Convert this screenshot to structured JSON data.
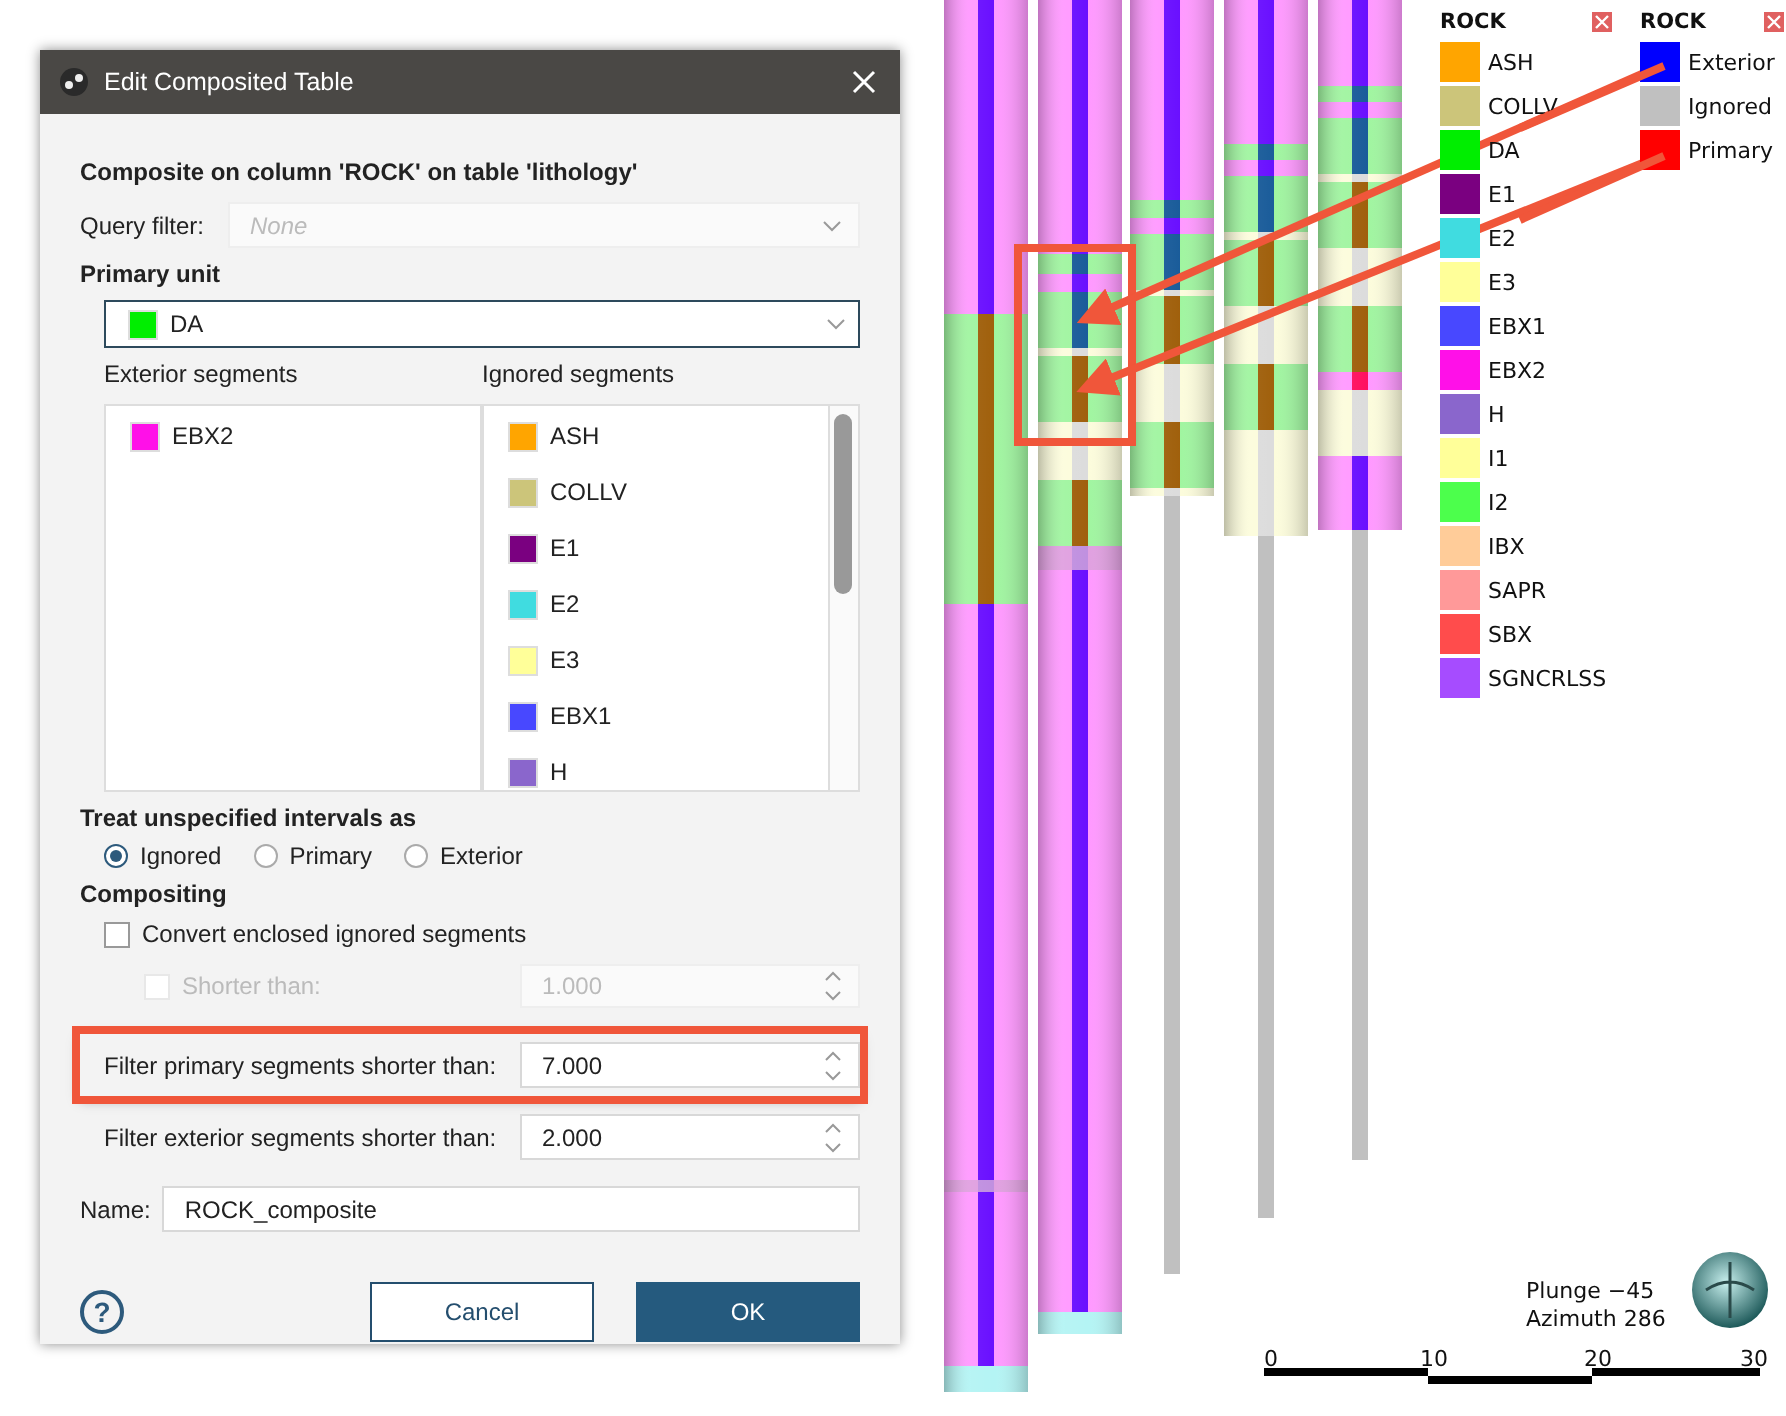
{
  "dialog": {
    "title": "Edit Composited Table",
    "heading": "Composite on column 'ROCK' on table 'lithology'",
    "query_filter": {
      "label": "Query filter:",
      "placeholder": "None",
      "disabled": true
    },
    "primary_unit": {
      "label": "Primary unit",
      "value": "DA",
      "color": "#00ee00"
    },
    "exterior_segments": {
      "label": "Exterior segments",
      "items": [
        {
          "label": "EBX2",
          "color": "#ff10e8"
        }
      ]
    },
    "ignored_segments": {
      "label": "Ignored segments",
      "items": [
        {
          "label": "ASH",
          "color": "#ffa500"
        },
        {
          "label": "COLLV",
          "color": "#ccc57a"
        },
        {
          "label": "E1",
          "color": "#7a0080"
        },
        {
          "label": "E2",
          "color": "#40dce0"
        },
        {
          "label": "E3",
          "color": "#ffff99"
        },
        {
          "label": "EBX1",
          "color": "#4848ff"
        },
        {
          "label": "H",
          "color": "#8a66cc"
        }
      ]
    },
    "treat_unspecified": {
      "label": "Treat unspecified intervals as",
      "options": [
        {
          "label": "Ignored",
          "selected": true
        },
        {
          "label": "Primary",
          "selected": false
        },
        {
          "label": "Exterior",
          "selected": false
        }
      ]
    },
    "compositing": {
      "label": "Compositing",
      "convert": {
        "label": "Convert enclosed ignored segments",
        "checked": false
      },
      "shorter_than": {
        "label": "Shorter than:",
        "value": "1.000",
        "checked": false,
        "disabled": true
      }
    },
    "filter_primary": {
      "label": "Filter primary segments shorter than:",
      "value": "7.000",
      "highlighted": true
    },
    "filter_exterior": {
      "label": "Filter exterior segments shorter than:",
      "value": "2.000"
    },
    "name": {
      "label": "Name:",
      "value": "ROCK_composite"
    },
    "help": "?",
    "buttons": [
      {
        "label": "Cancel",
        "kind": "secondary"
      },
      {
        "label": "OK",
        "kind": "primary"
      }
    ]
  },
  "viewer": {
    "legends": [
      {
        "title": "ROCK",
        "items": [
          {
            "label": "ASH",
            "color": "#ffa500"
          },
          {
            "label": "COLLV",
            "color": "#ccc57a"
          },
          {
            "label": "DA",
            "color": "#00ee00"
          },
          {
            "label": "E1",
            "color": "#7a0080"
          },
          {
            "label": "E2",
            "color": "#40dce0"
          },
          {
            "label": "E3",
            "color": "#ffff99"
          },
          {
            "label": "EBX1",
            "color": "#4848ff"
          },
          {
            "label": "EBX2",
            "color": "#ff10e8"
          },
          {
            "label": "H",
            "color": "#8a66cc"
          },
          {
            "label": "I1",
            "color": "#ffff99"
          },
          {
            "label": "I2",
            "color": "#4cff4c"
          },
          {
            "label": "IBX",
            "color": "#ffcc99"
          },
          {
            "label": "SAPR",
            "color": "#ff9999"
          },
          {
            "label": "SBX",
            "color": "#ff4c4c"
          },
          {
            "label": "SGNCRLSS",
            "color": "#a64cff"
          }
        ]
      },
      {
        "title": "ROCK",
        "items": [
          {
            "label": "Exterior",
            "color": "#0000ff"
          },
          {
            "label": "Ignored",
            "color": "#c0c0c0"
          },
          {
            "label": "Primary",
            "color": "#ff0000"
          }
        ]
      }
    ],
    "plunge": "Plunge −45",
    "azimuth": "Azimuth 286",
    "scale_ticks": [
      "0",
      "10",
      "20",
      "30"
    ]
  }
}
